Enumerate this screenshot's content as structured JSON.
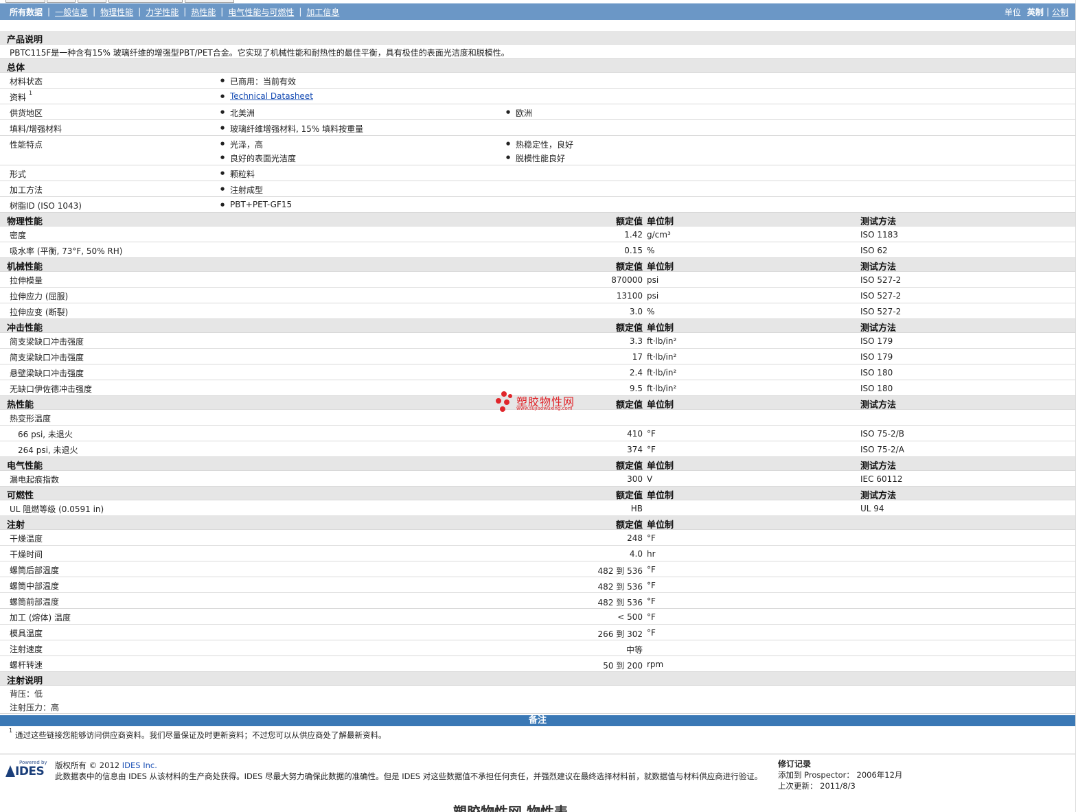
{
  "nav": {
    "links": [
      "所有数据",
      "一般信息",
      "物理性能",
      "力学性能",
      "热性能",
      "电气性能与可燃性",
      "加工信息"
    ],
    "units_label": "单位",
    "unit_en": "英制",
    "unit_metric": "公制"
  },
  "product": {
    "title": "产品说明",
    "text": "PBTC115F是一种含有15% 玻璃纤维的增强型PBT/PET合金。它实现了机械性能和耐热性的最佳平衡，具有极佳的表面光洁度和脱模性。"
  },
  "general": {
    "title": "总体",
    "rows": [
      {
        "label": "材料状态",
        "items": [
          "已商用：当前有效"
        ]
      },
      {
        "label": "资料",
        "sup": "1",
        "items": [
          "Technical Datasheet"
        ],
        "link": true
      },
      {
        "label": "供货地区",
        "items": [
          "北美洲",
          "欧洲"
        ]
      },
      {
        "label": "填料/增强材料",
        "items": [
          "玻璃纤维增强材料, 15% 填料按重量"
        ]
      },
      {
        "label": "性能特点",
        "items": [
          "光泽，高",
          "热稳定性，良好",
          "良好的表面光洁度",
          "脱模性能良好"
        ]
      },
      {
        "label": "形式",
        "items": [
          "颗粒料"
        ]
      },
      {
        "label": "加工方法",
        "items": [
          "注射成型"
        ]
      },
      {
        "label": "树脂ID (ISO 1043)",
        "items": [
          "PBT+PET-GF15"
        ]
      }
    ]
  },
  "headers": {
    "value": "额定值",
    "unit": "单位制",
    "method": "测试方法"
  },
  "sections": [
    {
      "title": "物理性能",
      "method": true,
      "rows": [
        {
          "label": "密度",
          "value": "1.42",
          "unit": "g/cm³",
          "method": "ISO 1183"
        },
        {
          "label": "吸水率 (平衡, 73°F, 50% RH)",
          "value": "0.15",
          "unit": "%",
          "method": "ISO 62"
        }
      ]
    },
    {
      "title": "机械性能",
      "method": true,
      "rows": [
        {
          "label": "拉伸模量",
          "value": "870000",
          "unit": "psi",
          "method": "ISO 527-2"
        },
        {
          "label": "拉伸应力 (屈服)",
          "value": "13100",
          "unit": "psi",
          "method": "ISO 527-2"
        },
        {
          "label": "拉伸应变 (断裂)",
          "value": "3.0",
          "unit": "%",
          "method": "ISO 527-2"
        }
      ]
    },
    {
      "title": "冲击性能",
      "method": true,
      "rows": [
        {
          "label": "简支梁缺口冲击强度",
          "value": "3.3",
          "unit": "ft·lb/in²",
          "method": "ISO 179"
        },
        {
          "label": "简支梁缺口冲击强度",
          "value": "17",
          "unit": "ft·lb/in²",
          "method": "ISO 179"
        },
        {
          "label": "悬壁梁缺口冲击强度",
          "value": "2.4",
          "unit": "ft·lb/in²",
          "method": "ISO 180"
        },
        {
          "label": "无缺口伊佐德冲击强度",
          "value": "9.5",
          "unit": "ft·lb/in²",
          "method": "ISO 180"
        }
      ]
    },
    {
      "title": "热性能",
      "method": true,
      "rows": [
        {
          "label": "热变形温度",
          "value": "",
          "unit": "",
          "method": ""
        },
        {
          "label": "66 psi, 未退火",
          "indent": true,
          "value": "410",
          "unit": "°F",
          "method": "ISO 75-2/B"
        },
        {
          "label": "264 psi, 未退火",
          "indent": true,
          "value": "374",
          "unit": "°F",
          "method": "ISO 75-2/A"
        }
      ]
    },
    {
      "title": "电气性能",
      "method": true,
      "rows": [
        {
          "label": "漏电起痕指数",
          "value": "300",
          "unit": "V",
          "method": "IEC 60112"
        }
      ]
    },
    {
      "title": "可燃性",
      "method": true,
      "rows": [
        {
          "label": "UL 阻燃等级 (0.0591 in)",
          "value": "HB",
          "unit": "",
          "method": "UL 94"
        }
      ]
    },
    {
      "title": "注射",
      "method": false,
      "rows": [
        {
          "label": "干燥温度",
          "value": "248",
          "unit": "°F",
          "method": ""
        },
        {
          "label": "干燥时间",
          "value": "4.0",
          "unit": "hr",
          "method": ""
        },
        {
          "label": "螺筒后部温度",
          "value": "482 到  536",
          "unit": "°F",
          "method": ""
        },
        {
          "label": "螺筒中部温度",
          "value": "482 到  536",
          "unit": "°F",
          "method": ""
        },
        {
          "label": "螺筒前部温度",
          "value": "482 到  536",
          "unit": "°F",
          "method": ""
        },
        {
          "label": "加工 (熔体) 温度",
          "value": "< 500",
          "unit": "°F",
          "method": ""
        },
        {
          "label": "模具温度",
          "value": "266 到  302",
          "unit": "°F",
          "method": ""
        },
        {
          "label": "注射速度",
          "value": "中等",
          "unit": "",
          "method": ""
        },
        {
          "label": "螺杆转速",
          "value": "50 到  200",
          "unit": "rpm",
          "method": ""
        }
      ]
    }
  ],
  "injection_notes": {
    "title": "注射说明",
    "lines": [
      "背压：低",
      "注射压力：高"
    ]
  },
  "remarks": {
    "title": "备注",
    "sup": "1",
    "text": "通过这些链接您能够访问供应商资料。我们尽量保证及时更新资料；不过您可以从供应商处了解最新资料。"
  },
  "footer": {
    "powered_by": "Powered by",
    "logo": "IDES",
    "copyright": "版权所有 © 2012",
    "company": "IDES Inc.",
    "disclaimer": "此数据表中的信息由 IDES 从该材料的生产商处获得。IDES 尽最大努力确保此数据的准确性。但是 IDES 对这些数据值不承担任何责任，并强烈建议在最终选择材料前，就数据值与材料供应商进行验证。",
    "revision_title": "修订记录",
    "added_label": "添加到 Prospector：",
    "added_value": "2006年12月",
    "updated_label": "上次更新：",
    "updated_value": "2011/8/3"
  },
  "watermark": {
    "cn": "塑胶物性网",
    "en": "www.sujiaowuxing.com"
  },
  "bottom_fragment": "塑胶物性网 物性表"
}
